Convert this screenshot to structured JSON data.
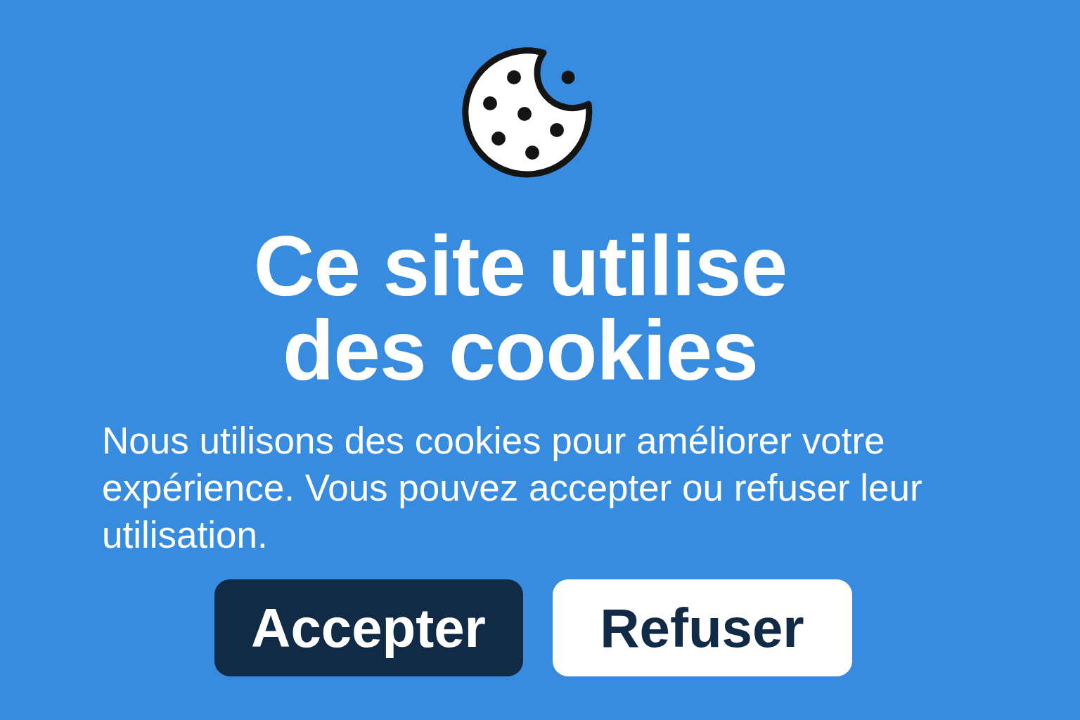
{
  "banner": {
    "title": "Ce site utilise des cookies",
    "message": "Nous utilisons des cookies pour améliorer votre expérience. Vous pouvez accepter ou refuser leur utilisation.",
    "buttons": [
      {
        "label": "Accepter",
        "kind": "primary"
      },
      {
        "label": "Refuser",
        "kind": "secondary"
      }
    ]
  }
}
